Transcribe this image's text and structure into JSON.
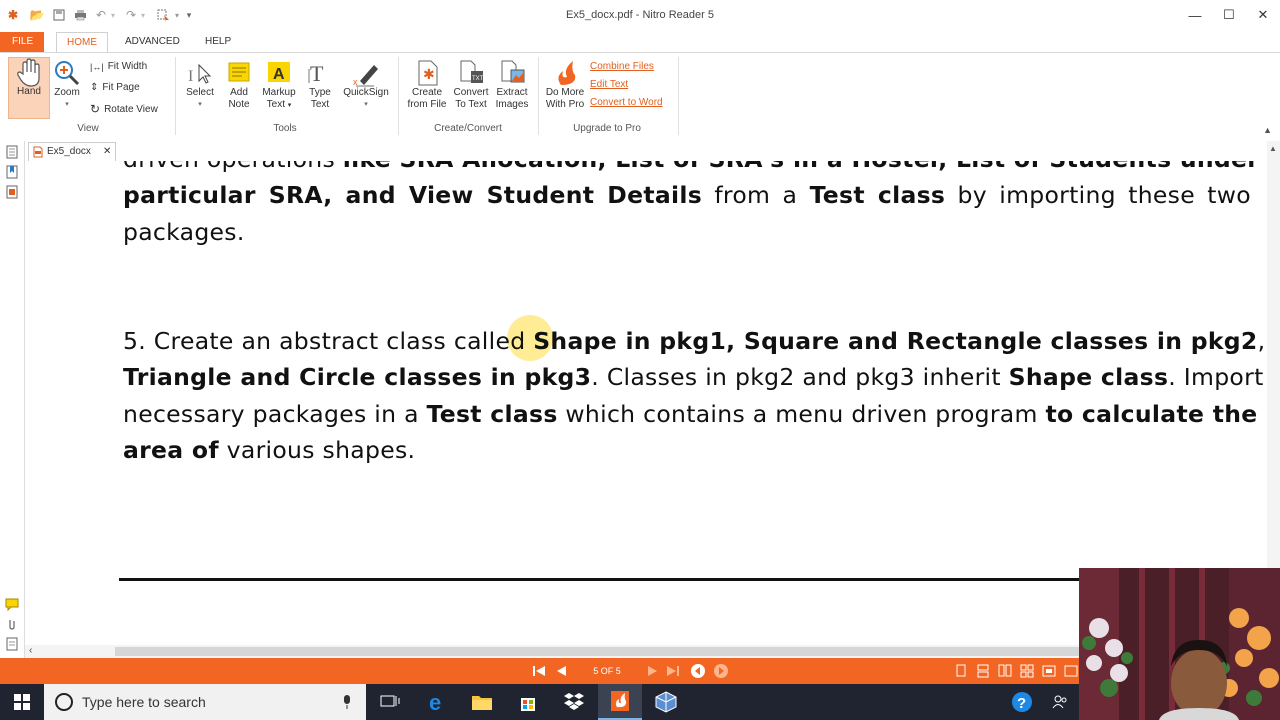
{
  "window": {
    "title": "Ex5_docx.pdf - Nitro Reader 5",
    "minimize": "—",
    "maximize": "☐",
    "close": "✕"
  },
  "ribbon_tabs": [
    "FILE",
    "HOME",
    "ADVANCED",
    "HELP"
  ],
  "ribbon": {
    "view_group": {
      "hand": "Hand",
      "zoom": "Zoom",
      "fit_width": "Fit Width",
      "fit_page": "Fit Page",
      "rotate_view": "Rotate View",
      "label": "View"
    },
    "tools_group": {
      "select": "Select",
      "add_note_1": "Add",
      "add_note_2": "Note",
      "markup_1": "Markup",
      "markup_2": "Text",
      "type_1": "Type",
      "type_2": "Text",
      "quicksign": "QuickSign",
      "label": "Tools"
    },
    "create_group": {
      "create_1": "Create",
      "create_2": "from File",
      "convert_1": "Convert",
      "convert_2": "To Text",
      "extract_1": "Extract",
      "extract_2": "Images",
      "label": "Create/Convert"
    },
    "upgrade_group": {
      "domore_1": "Do More",
      "domore_2": "With Pro",
      "combine": "Combine Files",
      "edit_text": "Edit Text",
      "convert_word": "Convert to Word",
      "label": "Upgrade to Pro"
    }
  },
  "doc_tab": {
    "label": "Ex5_docx",
    "close": "✕"
  },
  "document": {
    "l0": {
      "a": "driven operations ",
      "b": "like SRA Allocation, List of SRA's in a Hostel, List of Students under a"
    },
    "l1": {
      "a": "particular SRA, and View Student Details",
      "b": " from a ",
      "c": "Test class",
      "d": " by importing these two"
    },
    "l2": "packages.",
    "l3": {
      "a": "5. Create an abstract class called ",
      "b": "Shape in pkg1, Square and Rectangle classes in pkg2",
      "c": ","
    },
    "l4": {
      "a": "Triangle and Circle classes in pkg3",
      "b": ". Classes in pkg2 and pkg3 inherit ",
      "c": "Shape class",
      "d": ". Import the"
    },
    "l5": {
      "a": "necessary packages in a ",
      "b": "Test class",
      "c": " which contains a menu driven program ",
      "d": "to calculate the"
    },
    "l6": {
      "a": "area of",
      "b": " various shapes."
    }
  },
  "status": {
    "page": "5 OF 5"
  },
  "taskbar": {
    "search_placeholder": "Type here to search"
  },
  "colors": {
    "accent": "#f26522",
    "taskbar": "#1f2430",
    "link": "#e2601f"
  }
}
